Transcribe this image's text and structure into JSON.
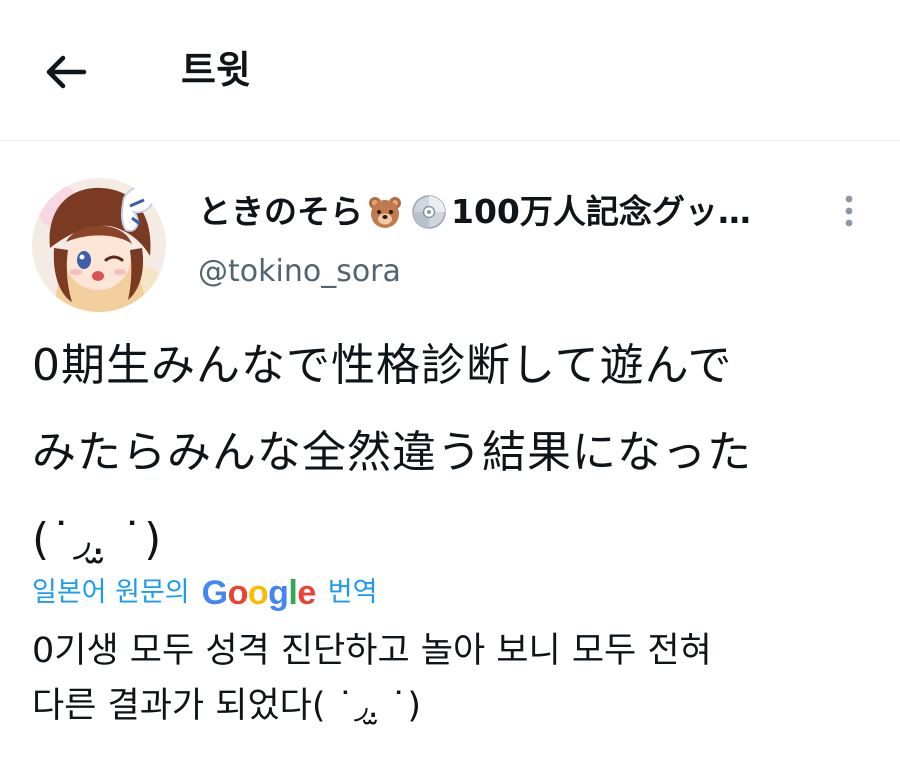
{
  "header": {
    "title": "트윗",
    "back_icon": "arrow-left-icon"
  },
  "tweet": {
    "display_name_prefix": "ときのそら",
    "display_name_suffix": "100万人記念グッ…",
    "name_emojis": [
      "bear-face-icon",
      "optical-disc-icon"
    ],
    "handle": "@tokino_sora",
    "text": "0期生みんなで性格診断して遊んで\nみたらみんな全然違う結果になった\n(˙◞.̫ ˙)",
    "translate_prefix": "일본어 원문의",
    "translate_provider": "Google",
    "translate_suffix": "번역",
    "translation": "0기생 모두 성격 진단하고 놀아 보니 모두 전혀\n다른 결과가 되었다( ˙◞.̫ ˙)"
  },
  "colors": {
    "link": "#1d9bf0",
    "secondary_text": "#536471",
    "primary_text": "#0f1419",
    "divider": "#e6e6e6"
  }
}
